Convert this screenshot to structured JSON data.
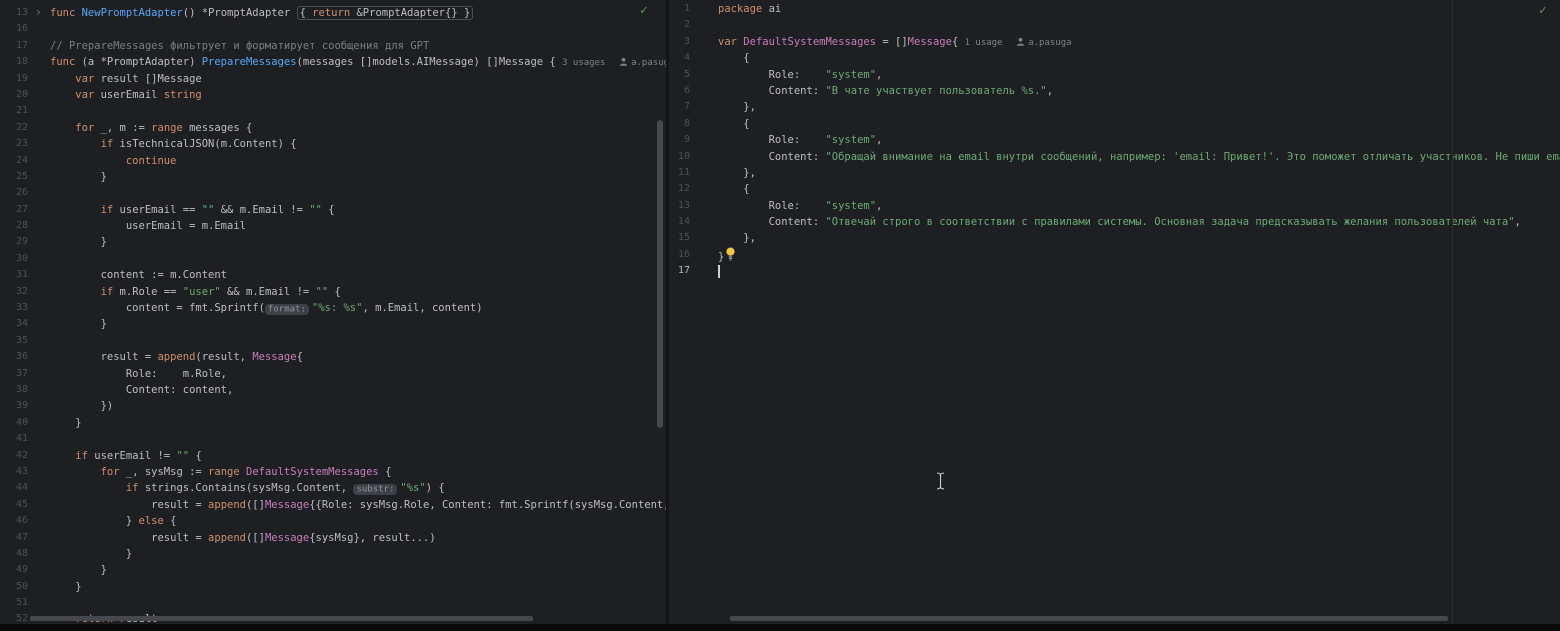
{
  "theme": {
    "background": "#1e1f22",
    "default_text": "#bcbec4",
    "keyword": "#cf8e6d",
    "function_decl": "#56a8f5",
    "string": "#6aab73",
    "comment": "#7a7e85",
    "global_and_type": "#c77dbb",
    "line_number": "#4b5059",
    "hint": "#7d8189",
    "check_ok": "#57965c",
    "bulb": "#f5c544"
  },
  "icons": {
    "author": "author-icon",
    "bulb": "intention-bulb-icon",
    "fold": "fold-arrow-icon",
    "check": "inspections-ok-icon",
    "mouse": "mouse-cursor-ibeam"
  },
  "left_editor": {
    "checkmark": "✓",
    "lines": [
      {
        "n": 13,
        "fold": true,
        "segs": [
          [
            "func ",
            "kw"
          ],
          [
            "NewPromptAdapter",
            "fn"
          ],
          [
            "() *PromptAdapter ",
            "def"
          ],
          {
            "box": [
              [
                "{ ",
                "def"
              ],
              [
                "return",
                "kw"
              ],
              [
                " &PromptAdapter{} }",
                "def"
              ]
            ]
          }
        ]
      },
      {
        "n": 16,
        "segs": []
      },
      {
        "n": 17,
        "segs": [
          [
            "// PrepareMessages фильтрует и форматирует сообщения для GPT",
            "com"
          ]
        ]
      },
      {
        "n": 18,
        "segs": [
          [
            "func ",
            "kw"
          ],
          [
            "(a *PromptAdapter) ",
            "def"
          ],
          [
            "PrepareMessages",
            "fn"
          ],
          [
            "(messages []models.AIMessage) []Message { ",
            "def"
          ],
          [
            "3 usages",
            "hint"
          ],
          [
            "  ",
            "def"
          ],
          {
            "icon": "author"
          },
          [
            "a.pasuga",
            "hint"
          ]
        ]
      },
      {
        "n": 19,
        "segs": [
          [
            "    ",
            "def"
          ],
          [
            "var",
            "kw"
          ],
          [
            " result []Message",
            "def"
          ]
        ]
      },
      {
        "n": 20,
        "segs": [
          [
            "    ",
            "def"
          ],
          [
            "var",
            "kw"
          ],
          [
            " userEmail ",
            "def"
          ],
          [
            "string",
            "kw"
          ]
        ]
      },
      {
        "n": 21,
        "segs": []
      },
      {
        "n": 22,
        "segs": [
          [
            "    ",
            "def"
          ],
          [
            "for",
            "kw"
          ],
          [
            " _, m := ",
            "def"
          ],
          [
            "range",
            "kw"
          ],
          [
            " messages {",
            "def"
          ]
        ]
      },
      {
        "n": 23,
        "segs": [
          [
            "        ",
            "def"
          ],
          [
            "if",
            "kw"
          ],
          [
            " isTechnicalJSON(m.Content) {",
            "def"
          ]
        ]
      },
      {
        "n": 24,
        "segs": [
          [
            "            ",
            "def"
          ],
          [
            "continue",
            "kw"
          ]
        ]
      },
      {
        "n": 25,
        "segs": [
          [
            "        }",
            "def"
          ]
        ]
      },
      {
        "n": 26,
        "segs": []
      },
      {
        "n": 27,
        "segs": [
          [
            "        ",
            "def"
          ],
          [
            "if",
            "kw"
          ],
          [
            " userEmail == ",
            "def"
          ],
          [
            "\"\"",
            "str"
          ],
          [
            " && m.Email != ",
            "def"
          ],
          [
            "\"\"",
            "str"
          ],
          [
            " {",
            "def"
          ]
        ]
      },
      {
        "n": 28,
        "segs": [
          [
            "            userEmail = m.Email",
            "def"
          ]
        ]
      },
      {
        "n": 29,
        "segs": [
          [
            "        }",
            "def"
          ]
        ]
      },
      {
        "n": 30,
        "segs": []
      },
      {
        "n": 31,
        "segs": [
          [
            "        content := m.Content",
            "def"
          ]
        ]
      },
      {
        "n": 32,
        "segs": [
          [
            "        ",
            "def"
          ],
          [
            "if",
            "kw"
          ],
          [
            " m.Role == ",
            "def"
          ],
          [
            "\"user\"",
            "str"
          ],
          [
            " && m.Email != ",
            "def"
          ],
          [
            "\"\"",
            "str"
          ],
          [
            " {",
            "def"
          ]
        ]
      },
      {
        "n": 33,
        "segs": [
          [
            "            content = fmt.Sprintf(",
            "def"
          ],
          [
            "format:",
            "pill"
          ],
          [
            "\"%s: %s\"",
            "str"
          ],
          [
            ", m.Email, content)",
            "def"
          ]
        ]
      },
      {
        "n": 34,
        "segs": [
          [
            "        }",
            "def"
          ]
        ]
      },
      {
        "n": 35,
        "segs": []
      },
      {
        "n": 36,
        "segs": [
          [
            "        result = ",
            "def"
          ],
          [
            "append",
            "kw"
          ],
          [
            "(result, ",
            "def"
          ],
          [
            "Message",
            "pur"
          ],
          [
            "{",
            "def"
          ]
        ]
      },
      {
        "n": 37,
        "segs": [
          [
            "            Role:    m.Role,",
            "def"
          ]
        ]
      },
      {
        "n": 38,
        "segs": [
          [
            "            Content: content,",
            "def"
          ]
        ]
      },
      {
        "n": 39,
        "segs": [
          [
            "        })",
            "def"
          ]
        ]
      },
      {
        "n": 40,
        "segs": [
          [
            "    }",
            "def"
          ]
        ]
      },
      {
        "n": 41,
        "segs": []
      },
      {
        "n": 42,
        "segs": [
          [
            "    ",
            "def"
          ],
          [
            "if",
            "kw"
          ],
          [
            " userEmail != ",
            "def"
          ],
          [
            "\"\"",
            "str"
          ],
          [
            " {",
            "def"
          ]
        ]
      },
      {
        "n": 43,
        "segs": [
          [
            "        ",
            "def"
          ],
          [
            "for",
            "kw"
          ],
          [
            " _, sysMsg := ",
            "def"
          ],
          [
            "range",
            "kw"
          ],
          [
            " ",
            "def"
          ],
          [
            "DefaultSystemMessages",
            "pur"
          ],
          [
            " {",
            "def"
          ]
        ]
      },
      {
        "n": 44,
        "segs": [
          [
            "            ",
            "def"
          ],
          [
            "if",
            "kw"
          ],
          [
            " strings.Contains(sysMsg.Content, ",
            "def"
          ],
          [
            "substr:",
            "pill"
          ],
          [
            "\"%s\"",
            "str"
          ],
          [
            ") {",
            "def"
          ]
        ]
      },
      {
        "n": 45,
        "segs": [
          [
            "                result = ",
            "def"
          ],
          [
            "append",
            "kw"
          ],
          [
            "([]",
            "def"
          ],
          [
            "Message",
            "pur"
          ],
          [
            "{{Role: sysMsg.Role, Content: fmt.Sprintf(sysMsg.Content, us",
            "def"
          ]
        ]
      },
      {
        "n": 46,
        "segs": [
          [
            "            } ",
            "def"
          ],
          [
            "else",
            "kw"
          ],
          [
            " {",
            "def"
          ]
        ]
      },
      {
        "n": 47,
        "segs": [
          [
            "                result = ",
            "def"
          ],
          [
            "append",
            "kw"
          ],
          [
            "([]",
            "def"
          ],
          [
            "Message",
            "pur"
          ],
          [
            "{sysMsg}, result...)",
            "def"
          ]
        ]
      },
      {
        "n": 48,
        "segs": [
          [
            "            }",
            "def"
          ]
        ]
      },
      {
        "n": 49,
        "segs": [
          [
            "        }",
            "def"
          ]
        ]
      },
      {
        "n": 50,
        "segs": [
          [
            "    }",
            "def"
          ]
        ]
      },
      {
        "n": 51,
        "segs": []
      },
      {
        "n": 52,
        "segs": [
          [
            "    ",
            "def"
          ],
          [
            "return",
            "kw"
          ],
          [
            " result",
            "def"
          ]
        ]
      }
    ]
  },
  "right_editor": {
    "checkmark": "✓",
    "lines": [
      {
        "n": 1,
        "segs": [
          [
            "package",
            "kw"
          ],
          [
            " ai",
            "def"
          ]
        ]
      },
      {
        "n": 2,
        "segs": []
      },
      {
        "n": 3,
        "segs": [
          [
            "var ",
            "kw"
          ],
          [
            "DefaultSystemMessages",
            "pur"
          ],
          [
            " = []",
            "def"
          ],
          [
            "Message",
            "pur"
          ],
          [
            "{ ",
            "def"
          ],
          [
            "1 usage",
            "hint"
          ],
          [
            "  ",
            "def"
          ],
          {
            "icon": "author"
          },
          [
            "a.pasuga",
            "hint"
          ]
        ]
      },
      {
        "n": 4,
        "segs": [
          [
            "    {",
            "def"
          ]
        ]
      },
      {
        "n": 5,
        "segs": [
          [
            "        Role:    ",
            "def"
          ],
          [
            "\"system\"",
            "str"
          ],
          [
            ",",
            "def"
          ]
        ]
      },
      {
        "n": 6,
        "segs": [
          [
            "        Content: ",
            "def"
          ],
          [
            "\"В чате участвует пользователь %s.\"",
            "str"
          ],
          [
            ",",
            "def"
          ]
        ]
      },
      {
        "n": 7,
        "segs": [
          [
            "    },",
            "def"
          ]
        ]
      },
      {
        "n": 8,
        "segs": [
          [
            "    {",
            "def"
          ]
        ]
      },
      {
        "n": 9,
        "segs": [
          [
            "        Role:    ",
            "def"
          ],
          [
            "\"system\"",
            "str"
          ],
          [
            ",",
            "def"
          ]
        ]
      },
      {
        "n": 10,
        "segs": [
          [
            "        Content: ",
            "def"
          ],
          [
            "\"Обращай внимание на email внутри сообщений, например: 'email: Привет!'. Это поможет отличать участников. Не пиши email",
            "str"
          ]
        ]
      },
      {
        "n": 11,
        "segs": [
          [
            "    },",
            "def"
          ]
        ]
      },
      {
        "n": 12,
        "segs": [
          [
            "    {",
            "def"
          ]
        ]
      },
      {
        "n": 13,
        "segs": [
          [
            "        Role:    ",
            "def"
          ],
          [
            "\"system\"",
            "str"
          ],
          [
            ",",
            "def"
          ]
        ]
      },
      {
        "n": 14,
        "segs": [
          [
            "        Content: ",
            "def"
          ],
          [
            "\"Отвечай строго в соответствии с правилами системы. Основная задача предсказывать желания пользователей чата\"",
            "str"
          ],
          [
            ",",
            "def"
          ]
        ]
      },
      {
        "n": 15,
        "segs": [
          [
            "    },",
            "def"
          ]
        ]
      },
      {
        "n": 16,
        "segs": [
          [
            "}",
            "def"
          ],
          {
            "icon": "bulb"
          }
        ]
      },
      {
        "n": 17,
        "current": true,
        "segs": [
          {
            "caret": true
          }
        ]
      }
    ]
  }
}
